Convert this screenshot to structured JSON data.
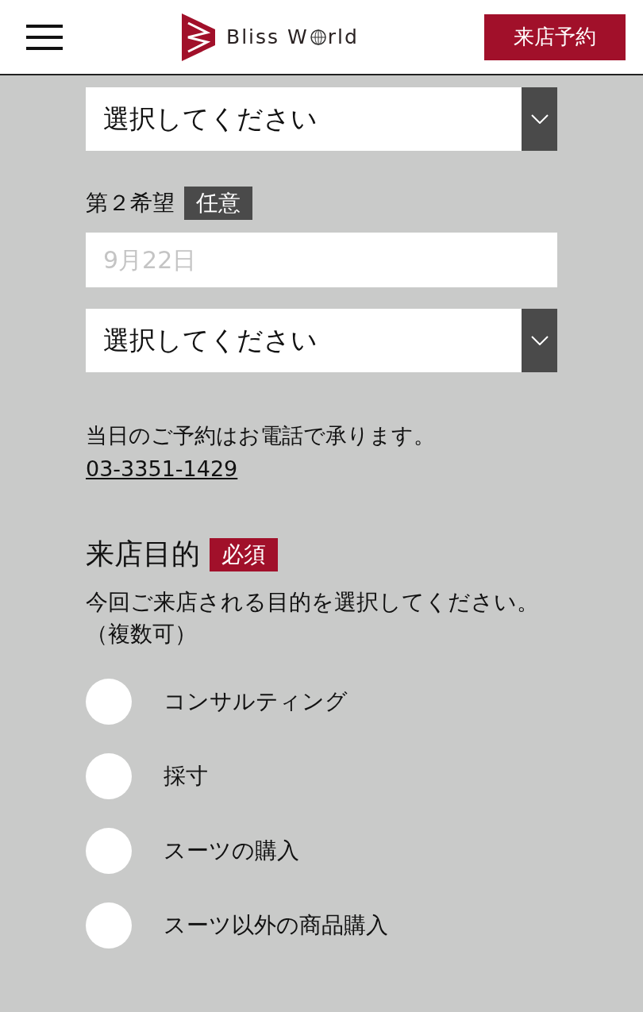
{
  "header": {
    "logo_text_before": "Bliss W",
    "logo_text_after": "rld",
    "reserve_button": "来店予約"
  },
  "first_choice": {
    "time_select": {
      "placeholder": "選択してください"
    }
  },
  "second_choice": {
    "label": "第２希望",
    "badge": {
      "text": "任意",
      "kind": "optional"
    },
    "date_field": {
      "placeholder": "9月22日"
    },
    "time_select": {
      "placeholder": "選択してください"
    }
  },
  "phone_note": {
    "text": "当日のご予約はお電話で承ります。",
    "phone": "03-3351-1429"
  },
  "purpose": {
    "title": "来店目的",
    "badge": {
      "text": "必須",
      "kind": "required"
    },
    "description": "今回ご来店される目的を選択してください。（複数可）",
    "options": [
      {
        "label": "コンサルティング",
        "checked": false
      },
      {
        "label": "採寸",
        "checked": false
      },
      {
        "label": "スーツの購入",
        "checked": false
      },
      {
        "label": "スーツ以外の商品購入",
        "checked": false
      }
    ]
  }
}
